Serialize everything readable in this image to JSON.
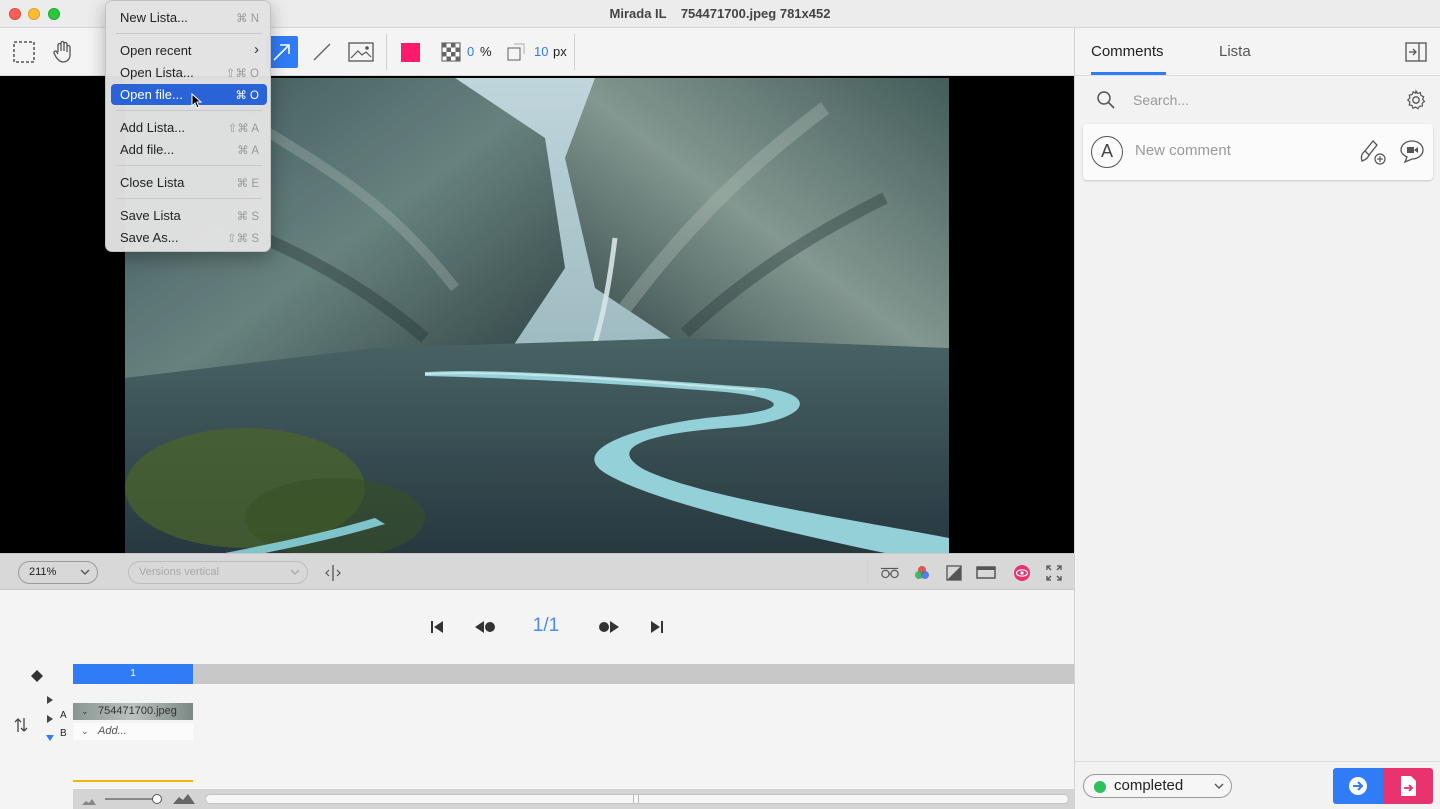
{
  "window": {
    "title": "Mirada IL    754471700.jpeg 781x452"
  },
  "toolbar": {
    "opacity_value": "0",
    "opacity_unit": "%",
    "stroke_value": "10",
    "stroke_unit": "px",
    "accent_color": "#ff1a6a"
  },
  "menu": {
    "items": [
      {
        "label": "New Lista...",
        "shortcut": "⌘ N"
      },
      {
        "label": "Open recent",
        "shortcut": "›"
      },
      {
        "label": "Open Lista...",
        "shortcut": "⇧⌘ O"
      },
      {
        "label": "Open file...",
        "shortcut": "⌘ O"
      },
      {
        "label": "Add Lista...",
        "shortcut": "⇧⌘ A"
      },
      {
        "label": "Add file...",
        "shortcut": "⌘ A"
      },
      {
        "label": "Close Lista",
        "shortcut": "⌘ E"
      },
      {
        "label": "Save Lista",
        "shortcut": "⌘ S"
      },
      {
        "label": "Save As...",
        "shortcut": "⇧⌘ S"
      }
    ]
  },
  "viewer": {
    "zoom": "211%",
    "layout_mode": "Versions vertical"
  },
  "transport": {
    "frame_counter": "1/1"
  },
  "timeline": {
    "frame_label": "1",
    "track_a": "A",
    "track_b": "B",
    "clip_a_name": "754471700.jpeg",
    "clip_b_name": "Add..."
  },
  "panel": {
    "tabs": [
      "Comments",
      "Lista"
    ],
    "active_tab": "Comments",
    "search_placeholder": "Search...",
    "avatar_letter": "A",
    "comment_placeholder": "New comment",
    "status": "completed",
    "status_color": "#2ec05a"
  }
}
